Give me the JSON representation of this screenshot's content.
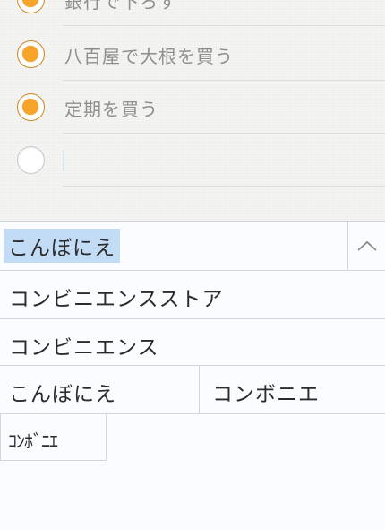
{
  "tasks": [
    {
      "label": "銀行で下ろす",
      "done": true
    },
    {
      "label": "八百屋で大根を買う",
      "done": true
    },
    {
      "label": "定期を買う",
      "done": true
    },
    {
      "label": "",
      "done": false
    }
  ],
  "ime": {
    "composing": "こんぼにえ",
    "collapse_icon": "chevron-up-icon",
    "candidates": [
      "コンビニエンスストア",
      "コンビニエンス",
      "こんぼにえ",
      "コンボニエ",
      "ｺﾝﾎﾞﾆｴ"
    ]
  },
  "colors": {
    "check_fill": "#f7a52a",
    "composing_highlight": "#c3dcf6"
  }
}
